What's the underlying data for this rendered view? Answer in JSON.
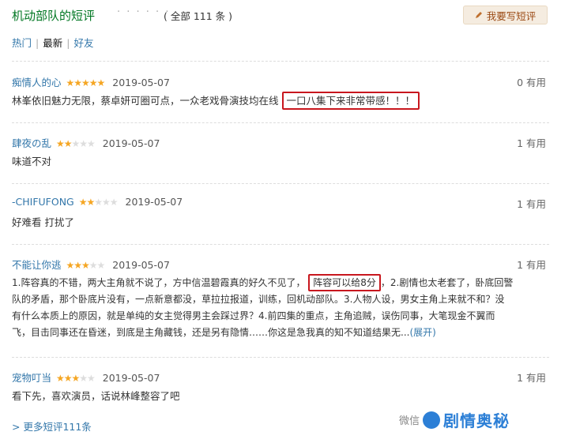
{
  "header": {
    "title": "机动部队的短评",
    "dots": "· · · · · ·",
    "count": "( 全部 111 条 )",
    "write_button": "我要写短评"
  },
  "tabs": [
    {
      "label": "热门",
      "active": false
    },
    {
      "label": "最新",
      "active": true
    },
    {
      "label": "好友",
      "active": false
    }
  ],
  "comments": [
    {
      "user": "痴情人的心",
      "stars": 5,
      "date": "2019-05-07",
      "votes": "0 有用",
      "text_plain": "林峯依旧魅力无限，蔡卓妍可圈可点，一众老戏骨演技均在线",
      "text_highlight": "一口八集下来非常带感！！！"
    },
    {
      "user": "肆夜の乱",
      "stars": 2,
      "date": "2019-05-07",
      "votes": "1 有用",
      "text_plain": "味道不对"
    },
    {
      "user": "-CHIFUFONG",
      "stars": 2,
      "date": "2019-05-07",
      "votes": "1 有用",
      "text_plain": "好难看 打扰了"
    },
    {
      "user": "不能让你逃",
      "stars": 3,
      "date": "2019-05-07",
      "votes": "1 有用",
      "line1_a": "1.阵容真的不错，两大主角就不说了，方中信温碧霞真的好久不见了，",
      "line1_hl": "阵容可以给8分",
      "line1_b": "，2.剧情也太老套了，卧底回警",
      "line2": "队的矛盾，那个卧底片没有，一点新意都没，草拉拉报道，训练，回机动部队。3.人物人设，男女主角上来就不和？没",
      "line3": "有什么本质上的原因，就是单纯的女主觉得男主会踩过界？4.前四集的重点，主角追贼，误伤同事，大笔现金不翼而",
      "line4": "飞，目击同事还在昏迷，到底是主角藏钱，还是另有隐情……你这是急我真的知不知道结果无...",
      "expand": "(展开)"
    },
    {
      "user": "宠物叮当",
      "stars": 3,
      "date": "2019-05-07",
      "votes": "1 有用",
      "text_plain": "看下先，喜欢演员，话说林峰整容了吧"
    }
  ],
  "more_link": "> 更多短评111条",
  "watermark": {
    "prefix": "微信",
    "brand": "剧情奥秘"
  },
  "colors": {
    "link": "#3377aa",
    "title": "#007722",
    "star": "#f5a623",
    "highlight_border": "#c8171e"
  }
}
